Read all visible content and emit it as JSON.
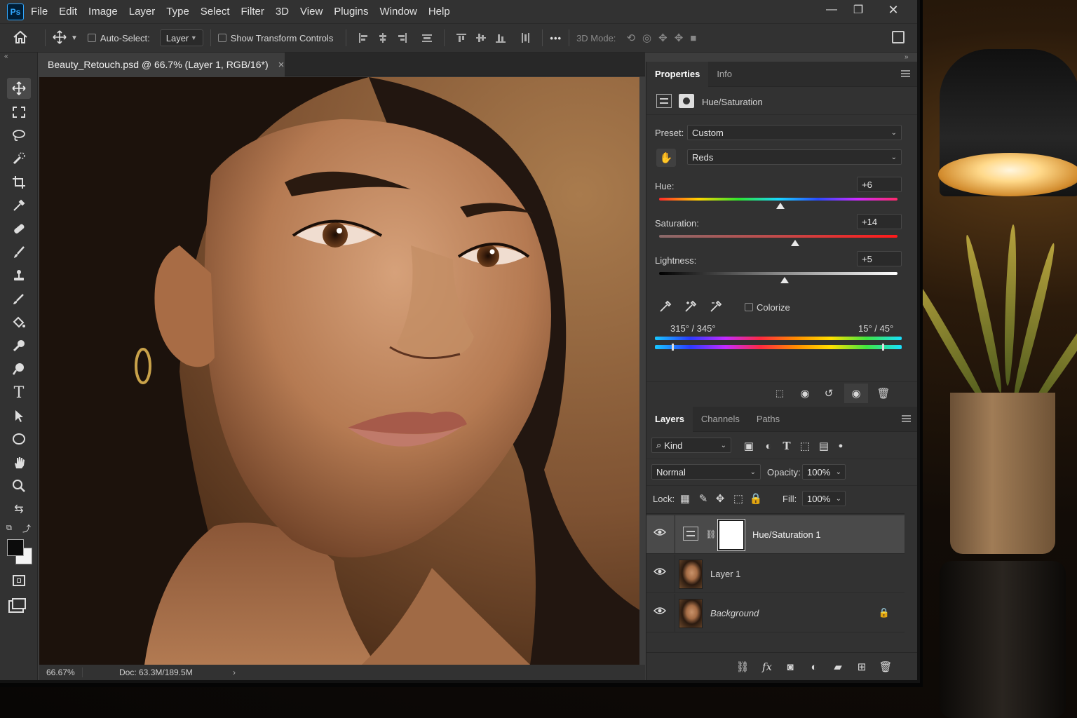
{
  "app": {
    "logo": "Ps"
  },
  "menubar": {
    "items": [
      "File",
      "Edit",
      "Image",
      "Layer",
      "Type",
      "Select",
      "Filter",
      "3D",
      "View",
      "Plugins",
      "Window",
      "Help"
    ]
  },
  "window_controls": {
    "minimize": "—",
    "restore": "❐",
    "close": "✕"
  },
  "options": {
    "auto_select_label": "Auto-Select:",
    "auto_select_value": "Layer",
    "show_transform_label": "Show Transform Controls",
    "more_label": "•••",
    "mode_3d_label": "3D Mode:"
  },
  "document": {
    "tab_title": "Beauty_Retouch.psd @ 66.7% (Layer 1, RGB/16*)",
    "tab_close": "×",
    "zoom": "66.67%",
    "doc_size": "Doc: 63.3M/189.5M",
    "status_arrow": "›"
  },
  "properties": {
    "tabs": [
      "Properties",
      "Info"
    ],
    "adjustment_title": "Hue/Saturation",
    "preset_label": "Preset:",
    "preset_value": "Custom",
    "channel_value": "Reds",
    "hue_label": "Hue:",
    "hue_value": "+6",
    "saturation_label": "Saturation:",
    "saturation_value": "+14",
    "lightness_label": "Lightness:",
    "lightness_value": "+5",
    "hue_level": 0.51,
    "saturation_level": 0.57,
    "lightness_level": 0.525,
    "colorize_label": "Colorize",
    "range_left": "315° / 345°",
    "range_right": "15° / 45°"
  },
  "layers_panel": {
    "tabs": [
      "Layers",
      "Channels",
      "Paths"
    ],
    "kind_label": "Kind",
    "blend_mode": "Normal",
    "opacity_label": "Opacity:",
    "opacity_value": "100%",
    "lock_label": "Lock:",
    "fill_label": "Fill:",
    "fill_value": "100%",
    "layers": [
      {
        "name": "Hue/Saturation 1"
      },
      {
        "name": "Layer 1"
      },
      {
        "name": "Background"
      }
    ]
  },
  "colors": {
    "accent": "#31a8ff",
    "panel": "#323232",
    "canvas_bg": "#8a5b34"
  }
}
